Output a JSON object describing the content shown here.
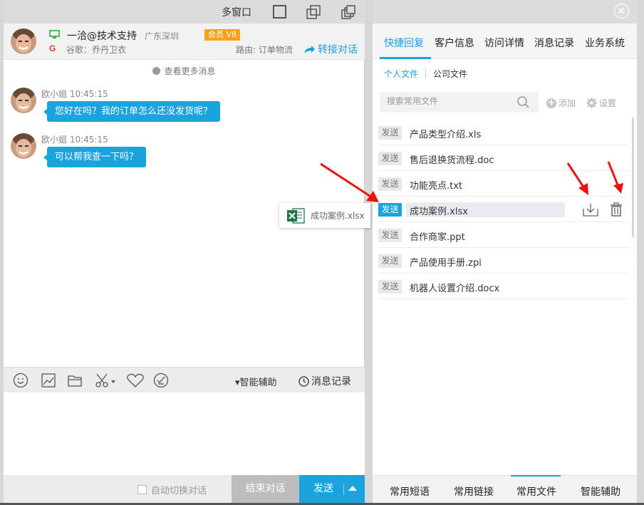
{
  "left": {
    "topbar": {
      "title": "多窗口"
    },
    "customer": {
      "name": "一洽@技术支持",
      "location": "广东深圳",
      "vip_label": "会员 V8",
      "source": "谷歌：乔丹卫衣",
      "route": "路由: 订单物流",
      "transfer": "转接对话"
    },
    "more_messages": "查看更多消息",
    "messages": [
      {
        "sender": "欧小姐",
        "time": "10:45:15",
        "text": "您好在吗？我的订单怎么还没发货呢？"
      },
      {
        "sender": "欧小姐",
        "time": "10:45:15",
        "text": "可以帮我查一下吗？"
      }
    ],
    "toolbar": {
      "smart_assist": "▾智能辅助",
      "history": "消息记录"
    },
    "bottom": {
      "auto_switch": "自动切换对话",
      "end": "结束对话",
      "send": "发送"
    }
  },
  "drag_file": {
    "name": "成功案例.xlsx"
  },
  "right": {
    "tabs": [
      "快捷回复",
      "客户信息",
      "访问详情",
      "消息记录",
      "业务系统"
    ],
    "subtabs": [
      "个人文件",
      "公司文件"
    ],
    "search": {
      "placeholder": "搜索常用文件"
    },
    "add_label": "添加",
    "settings_label": "设置",
    "send_tag": "发送",
    "files": [
      {
        "name": "产品类型介绍.xls"
      },
      {
        "name": "售后退换货流程.doc"
      },
      {
        "name": "功能亮点.txt"
      },
      {
        "name": "成功案例.xlsx"
      },
      {
        "name": "合作商家.ppt"
      },
      {
        "name": "产品使用手册.zpi"
      },
      {
        "name": "机器人设置介绍.docx"
      }
    ],
    "bottom_tabs": [
      "常用短语",
      "常用链接",
      "常用文件",
      "智能辅助"
    ]
  },
  "colors": {
    "accent": "#1aa3dc",
    "vip": "#f7a21a",
    "arrow": "#ee1111"
  }
}
